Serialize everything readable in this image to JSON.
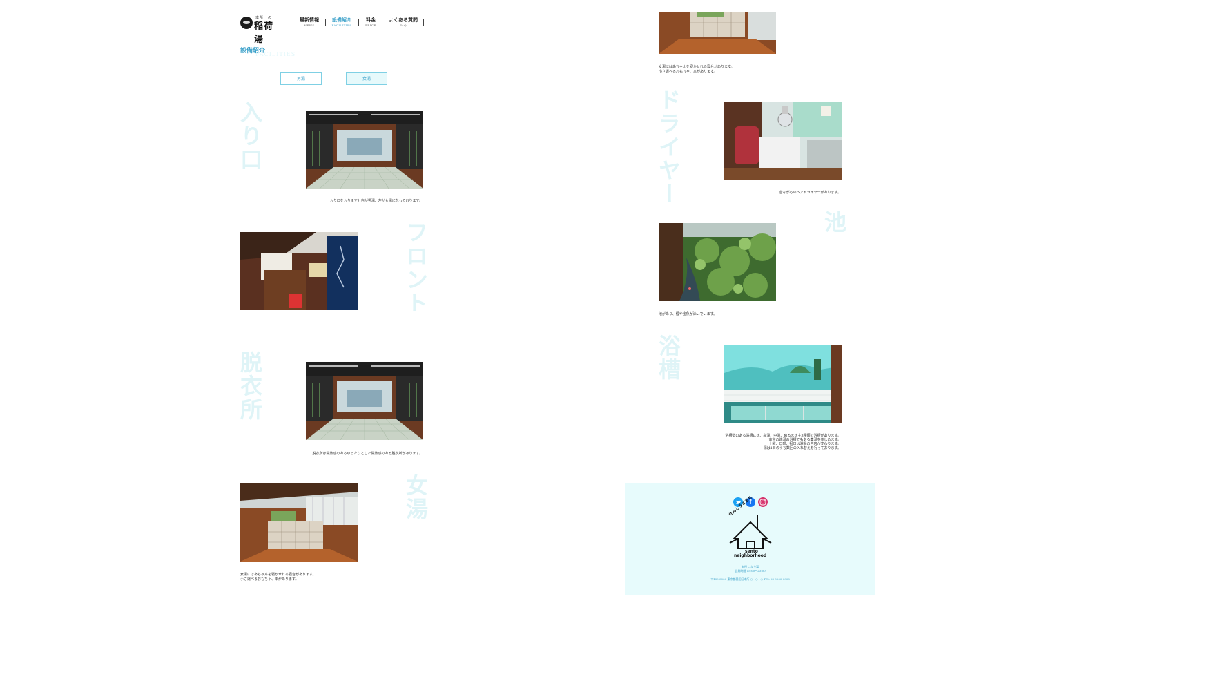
{
  "header": {
    "logo_small": "本所一の",
    "logo_text": "稲荷湯",
    "nav": [
      {
        "ja": "最新情報",
        "en": "NEWS"
      },
      {
        "ja": "設備紹介",
        "en": "FACILITIES"
      },
      {
        "ja": "料金",
        "en": "PRICE"
      },
      {
        "ja": "よくある質問",
        "en": "FAQ"
      }
    ]
  },
  "page": {
    "title": "設備紹介",
    "title_en": "FACILITIES"
  },
  "tabs": {
    "men": "男湯",
    "women": "女湯"
  },
  "sections": {
    "entrance": {
      "word": "入り口",
      "caption": "入り口を入りますと右が男湯、左が女湯になっております。"
    },
    "front": {
      "word": "フロント"
    },
    "dressing": {
      "word": "脱衣所",
      "caption": "脱衣所は開放感のあるゆったりとした開放感のある脱衣所があります。"
    },
    "women": {
      "word": "女湯",
      "caption_lines": [
        "女湯にはあちゃんを寝かせれる寝台があります。",
        "小さ運べるおもちゃ、本があります。"
      ]
    },
    "women2": {
      "caption_lines": [
        "女湯にはあちゃんを寝かせれる寝台があります。",
        "小さ運べるおもちゃ、本があります。"
      ]
    },
    "dryer": {
      "word": "ドライヤー",
      "caption": "昔ながらのヘアドライヤーがあります。"
    },
    "pond": {
      "word": "池",
      "caption": "池があり、鯉や金魚が泳いでいます。"
    },
    "bath": {
      "word": "浴槽",
      "caption_lines": [
        "浴槽壁のある浴槽には、高温、中温、ぬるまは主3種類の浴槽があります。",
        "東京の銭湯の浴槽でもある薬湯を楽しめます。",
        "土曜、日曜、祝日は浴場の内容が変わります。",
        "湯は1日のうち数回の入れ替えを行っております。"
      ]
    }
  },
  "footer": {
    "sns": [
      "twitter-icon",
      "facebook-icon",
      "instagram-icon"
    ],
    "logo_text_ja": "せんとうとまち",
    "logo_text_en1": "sento",
    "logo_text_en2": "neighborhood",
    "line1": "本所 いなり湯",
    "line2": "営業時間 15:00〜23:00",
    "line3": "〒130-0000 東京都墨田区本所 ○ - ○ - ○ TEL 03-0000-0000"
  },
  "colors": {
    "accent": "#3aa0c9",
    "watermark": "#dff4f7",
    "footer_bg": "#e7fbfc"
  }
}
